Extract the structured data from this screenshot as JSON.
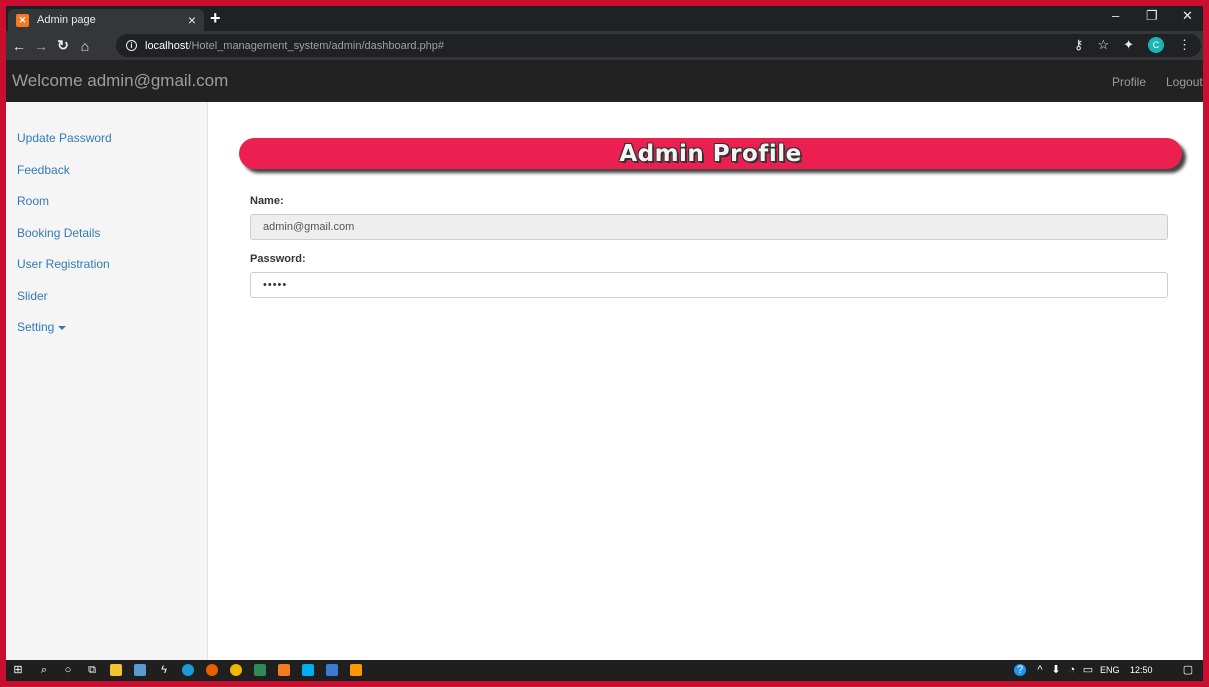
{
  "browser": {
    "tab_title": "Admin page",
    "tab_close": "×",
    "new_tab": "+",
    "url_host": "localhost",
    "url_path": "/Hotel_management_system/admin/dashboard.php#",
    "profile_initial": "C",
    "window_controls": [
      "–",
      "❐",
      "✕"
    ]
  },
  "navbar": {
    "brand": "Welcome admin@gmail.com",
    "links": [
      "Profile",
      "Logout"
    ]
  },
  "sidebar": {
    "items": [
      {
        "label": "Update Password"
      },
      {
        "label": "Feedback"
      },
      {
        "label": "Room"
      },
      {
        "label": "Booking Details"
      },
      {
        "label": "User Registration"
      },
      {
        "label": "Slider"
      },
      {
        "label": "Setting"
      }
    ]
  },
  "main": {
    "title": "Admin Profile",
    "name_label": "Name:",
    "name_value": "admin@gmail.com",
    "password_label": "Password:",
    "password_value": "•••••"
  },
  "taskbar": {
    "lang": "ENG",
    "time": "12:50"
  },
  "colors": {
    "banner": "#ec2050",
    "link": "#337ab7",
    "navbar": "#222222"
  }
}
